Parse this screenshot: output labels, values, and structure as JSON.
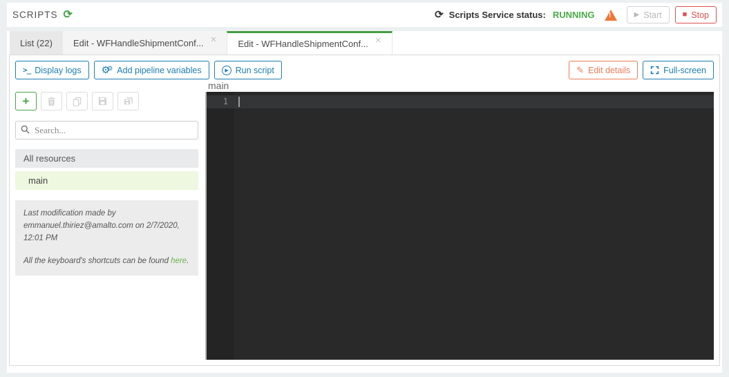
{
  "header": {
    "title": "SCRIPTS",
    "status_label": "Scripts Service status:",
    "status_value": "RUNNING",
    "start_label": "Start",
    "stop_label": "Stop"
  },
  "tabs": [
    {
      "label": "List (22)",
      "active": false,
      "closable": false
    },
    {
      "label": "Edit - WFHandleShipmentConf...",
      "active": false,
      "closable": true
    },
    {
      "label": "Edit - WFHandleShipmentConf...",
      "active": true,
      "closable": true
    }
  ],
  "toolbar": {
    "display_logs": "Display logs",
    "add_pipeline_variables": "Add pipeline variables",
    "run_script": "Run script",
    "edit_details": "Edit details",
    "fullscreen": "Full-screen"
  },
  "sidebar": {
    "search_placeholder": "Search...",
    "group_label": "All resources",
    "resources": [
      {
        "name": "main",
        "selected": true
      }
    ],
    "info_modification": "Last modification made by emmanuel.thiriez@amalto.com on 2/7/2020, 12:01 PM",
    "info_shortcuts_prefix": "All the keyboard's shortcuts can be found ",
    "info_shortcuts_link": "here",
    "info_shortcuts_suffix": "."
  },
  "editor": {
    "title": "main",
    "line_number": "1"
  },
  "icons": {
    "refresh": "⟳",
    "close": "×",
    "play": "▶",
    "stop_square": "■",
    "terminal": ">_",
    "gear": "⚙",
    "gear_small": "⚙",
    "pencil": "✎",
    "plus": "+"
  },
  "colors": {
    "accent_green": "#449d44",
    "accent_blue": "#1c7eb0",
    "accent_orange": "#ec7c56",
    "danger_red": "#d9534f",
    "warning_orange": "#f07636",
    "status_running_green": "#47ab47",
    "editor_bg": "#29292a",
    "selected_resource_bg": "#eef7e0"
  }
}
